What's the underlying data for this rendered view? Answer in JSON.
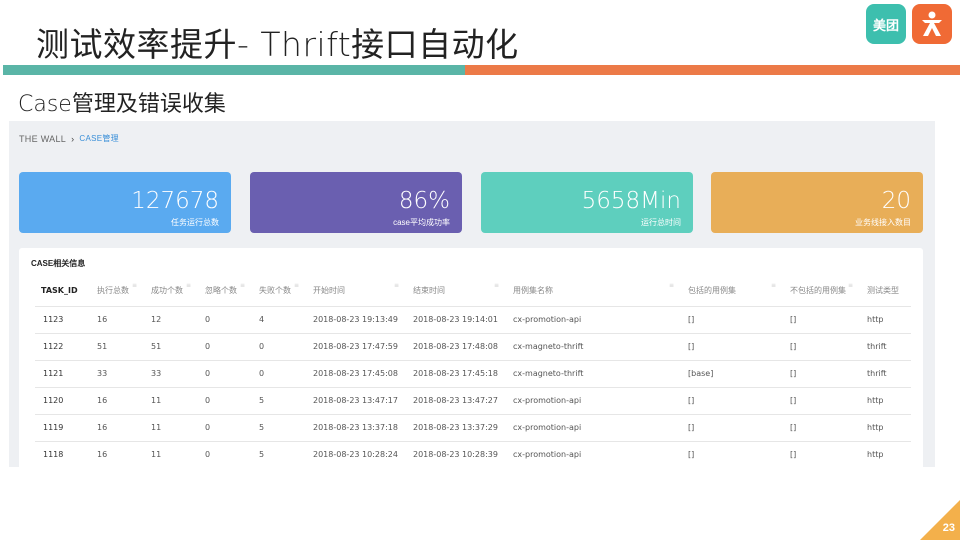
{
  "slide": {
    "title": "测试效率提升- Thrift接口自动化",
    "section": "Case管理及错误收集",
    "page_number": "23",
    "logo_meituan_text": "美团",
    "colors": {
      "green_bar": "#5ab5a7",
      "orange_bar": "#ec7a48",
      "page_badge": "#f3b04b"
    }
  },
  "breadcrumb": {
    "root": "THE WALL",
    "separator": "›",
    "current": "CASE管理"
  },
  "stats": [
    {
      "value": "127678",
      "label": "任务运行总数",
      "color": "#5aaaf0"
    },
    {
      "value": "86%",
      "label": "case平均成功率",
      "color": "#6a5fb0"
    },
    {
      "value": "5658Min",
      "label": "运行总时间",
      "color": "#5ecfbe"
    },
    {
      "value": "20",
      "label": "业务线接入数目",
      "color": "#e8ae58"
    }
  ],
  "panel": {
    "title": "CASE相关信息",
    "columns": [
      "TASK_ID",
      "执行总数",
      "成功个数",
      "忽略个数",
      "失败个数",
      "开始时间",
      "结束时间",
      "用例集名称",
      "包括的用例集",
      "不包括的用例集",
      "测试类型"
    ],
    "rows": [
      [
        "1123",
        "16",
        "12",
        "0",
        "4",
        "2018-08-23 19:13:49",
        "2018-08-23 19:14:01",
        "cx-promotion-api",
        "[]",
        "[]",
        "http"
      ],
      [
        "1122",
        "51",
        "51",
        "0",
        "0",
        "2018-08-23 17:47:59",
        "2018-08-23 17:48:08",
        "cx-magneto-thrift",
        "[]",
        "[]",
        "thrift"
      ],
      [
        "1121",
        "33",
        "33",
        "0",
        "0",
        "2018-08-23 17:45:08",
        "2018-08-23 17:45:18",
        "cx-magneto-thrift",
        "[base]",
        "[]",
        "thrift"
      ],
      [
        "1120",
        "16",
        "11",
        "0",
        "5",
        "2018-08-23 13:47:17",
        "2018-08-23 13:47:27",
        "cx-promotion-api",
        "[]",
        "[]",
        "http"
      ],
      [
        "1119",
        "16",
        "11",
        "0",
        "5",
        "2018-08-23 13:37:18",
        "2018-08-23 13:37:29",
        "cx-promotion-api",
        "[]",
        "[]",
        "http"
      ],
      [
        "1118",
        "16",
        "11",
        "0",
        "5",
        "2018-08-23 10:28:24",
        "2018-08-23 10:28:39",
        "cx-promotion-api",
        "[]",
        "[]",
        "http"
      ]
    ]
  }
}
